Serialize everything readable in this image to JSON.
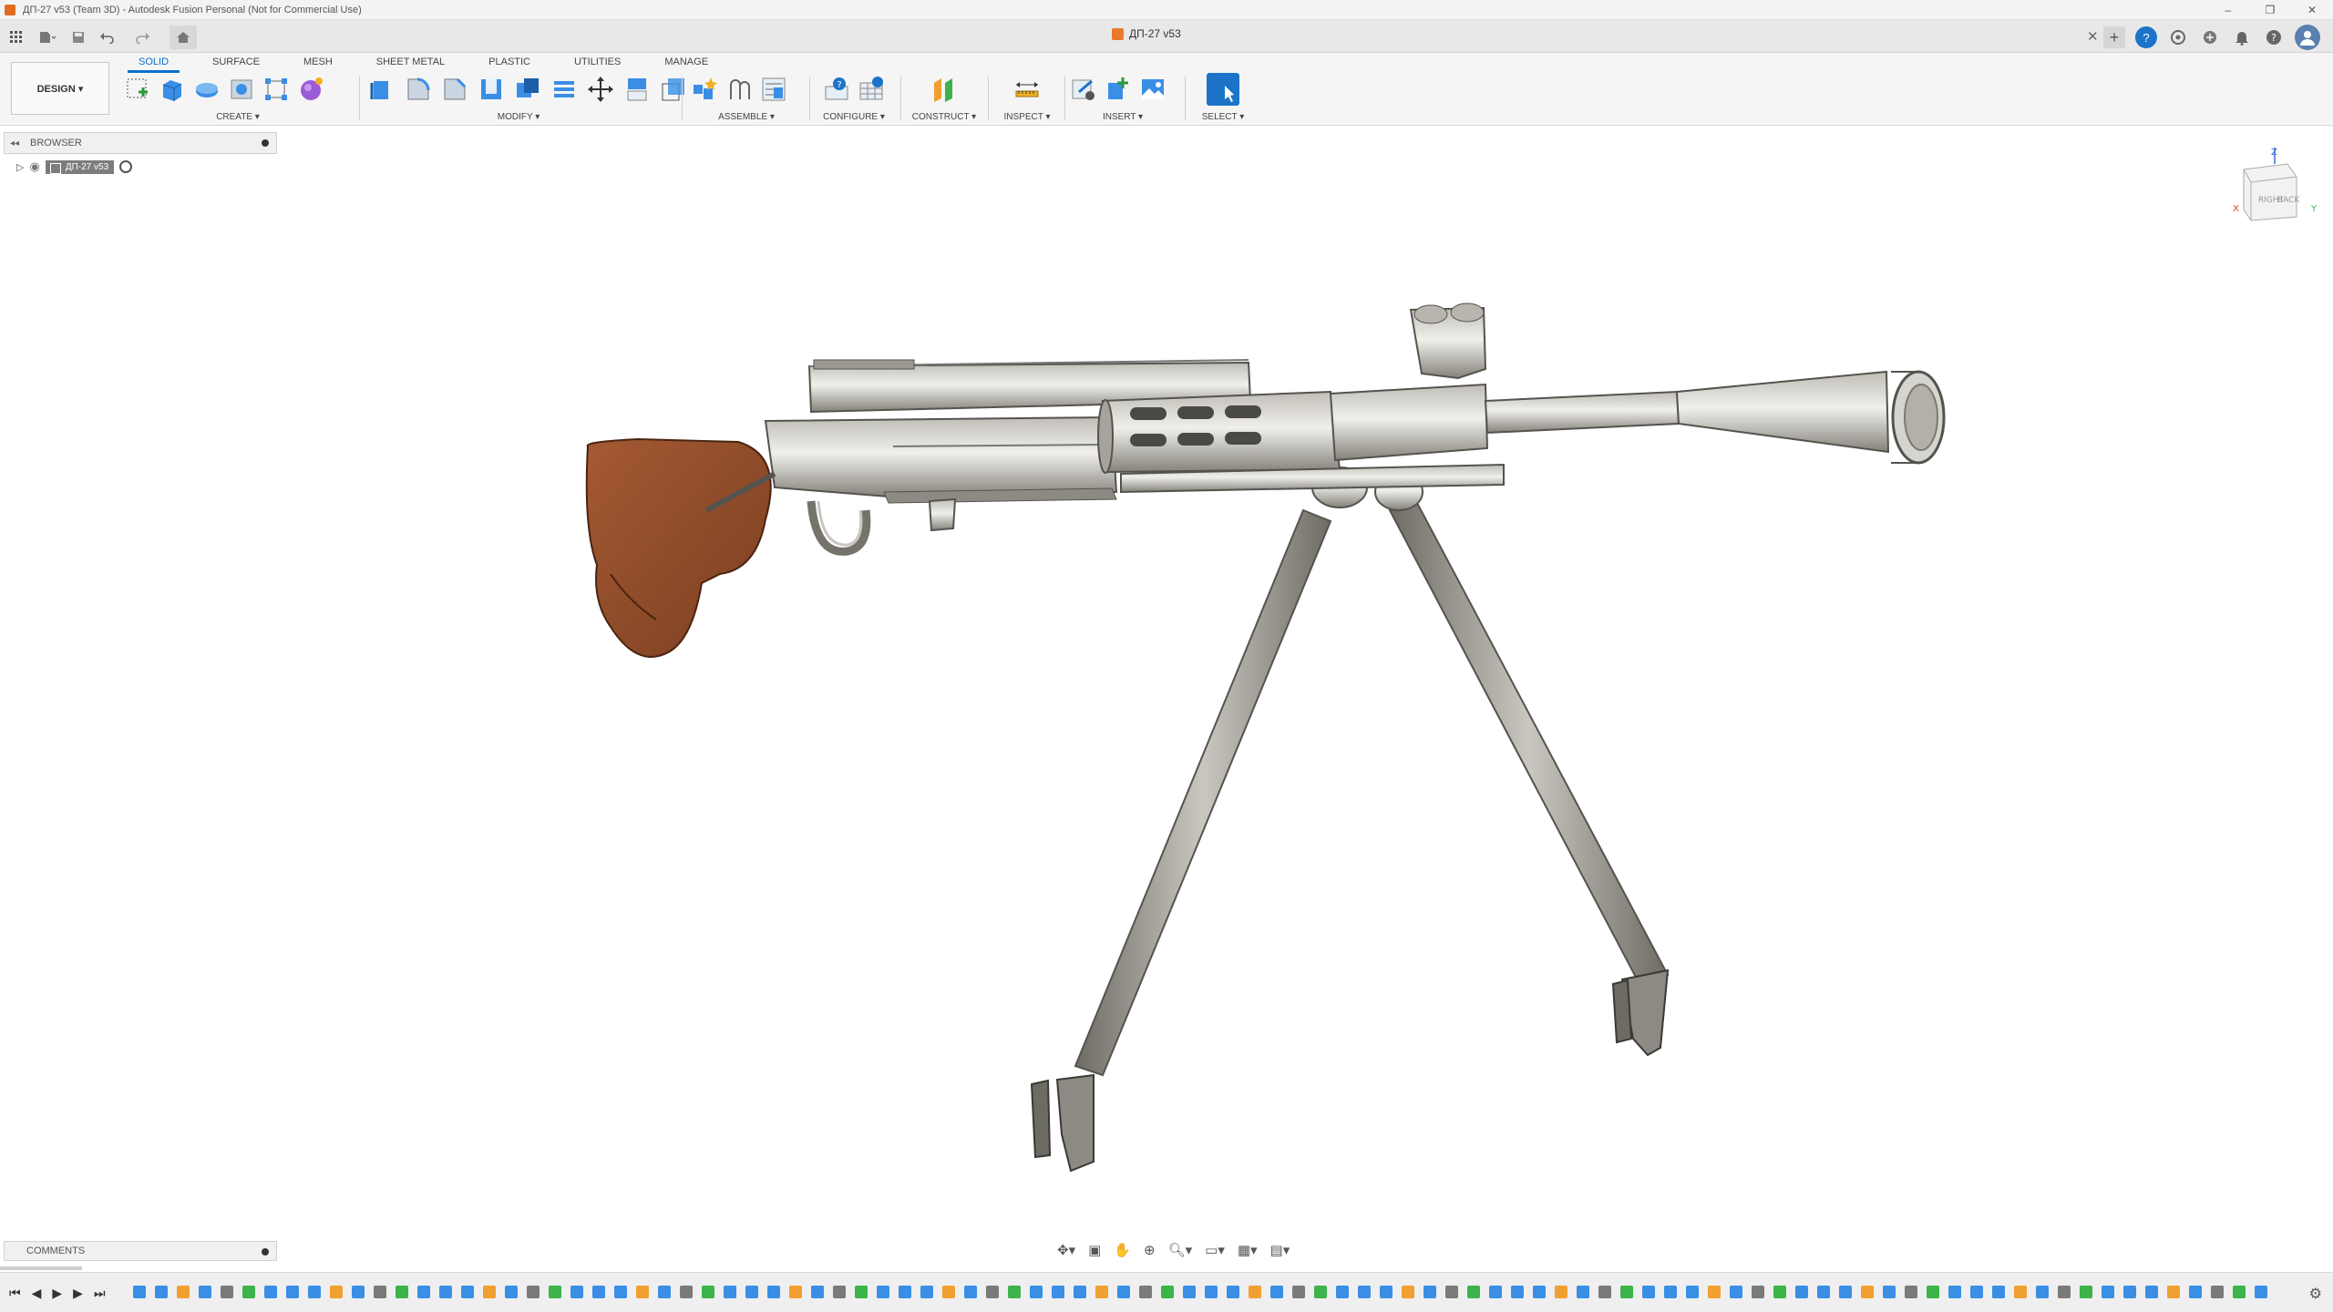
{
  "window": {
    "title": "ДП-27 v53 (Team 3D) - Autodesk Fusion Personal (Not for Commercial Use)",
    "minimize": "–",
    "restore": "❐",
    "close": "✕"
  },
  "doc_tab": {
    "name": "ДП-27 v53",
    "close": "✕"
  },
  "ribbon": {
    "workspace": "DESIGN ▾",
    "tabs": [
      "SOLID",
      "SURFACE",
      "MESH",
      "SHEET METAL",
      "PLASTIC",
      "UTILITIES",
      "MANAGE"
    ],
    "groups": {
      "create": "CREATE ▾",
      "modify": "MODIFY ▾",
      "assemble": "ASSEMBLE ▾",
      "configure": "CONFIGURE ▾",
      "construct": "CONSTRUCT ▾",
      "inspect": "INSPECT ▾",
      "insert": "INSERT ▾",
      "select": "SELECT ▾"
    }
  },
  "browser": {
    "label": "BROWSER",
    "root_node": "ДП-27 v53"
  },
  "viewcube": {
    "right": "RIGHT",
    "back": "BACK",
    "z": "Z",
    "x": "X",
    "y": "Y"
  },
  "comments": {
    "label": "COMMENTS"
  },
  "colors": {
    "accent": "#0b6fd3",
    "stock": "#8b4a2a",
    "metal": "#8f8d86"
  }
}
